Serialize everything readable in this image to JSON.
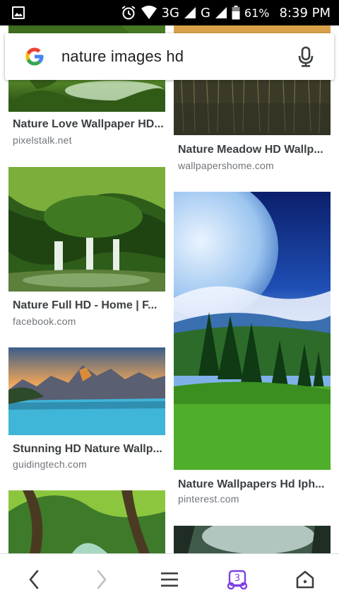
{
  "status_bar": {
    "network_1": "3G",
    "network_2": "G",
    "battery": "61%",
    "time": "8:39 PM"
  },
  "search": {
    "query": "nature images hd"
  },
  "results": [
    {
      "title": "Nature Love Wallpaper HD...",
      "source": "pixelstalk.net"
    },
    {
      "title": "Nature Meadow HD Wallp...",
      "source": "wallpapershome.com"
    },
    {
      "title": "Nature Full HD - Home | F...",
      "source": "facebook.com"
    },
    {
      "title": "Stunning HD Nature Wallp...",
      "source": "guidingtech.com"
    },
    {
      "title": "Nature Wallpapers Hd Iph...",
      "source": "pinterest.com"
    }
  ],
  "bottom_nav": {
    "tab_count": "3"
  },
  "colors": {
    "accent": "#7b3fe4",
    "google_blue": "#4285F4",
    "google_red": "#EA4335",
    "google_yellow": "#FBBC05",
    "google_green": "#34A853"
  }
}
